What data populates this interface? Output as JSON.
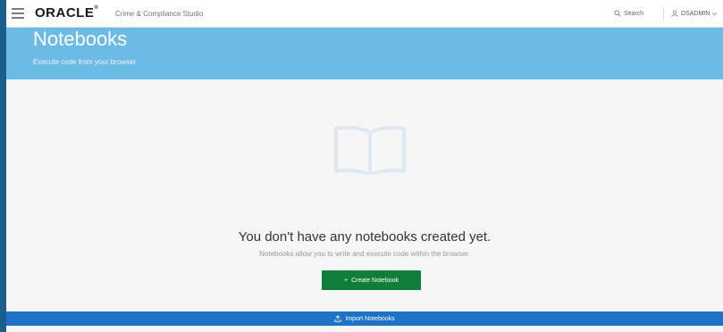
{
  "topbar": {
    "logo_text": "ORACLE",
    "logo_mark": "®",
    "product_name": "Crime & Compliance Studio",
    "search_label": "Search",
    "user_name": "DSADMIN"
  },
  "banner": {
    "title": "Notebooks",
    "subtitle": "Execute code from your browser"
  },
  "empty_state": {
    "icon": "book-open-icon",
    "title": "You don't have any notebooks created yet.",
    "description": "Notebooks allow you to write and execute code within the browser.",
    "create_label": "Create Notebook",
    "create_icon": "+"
  },
  "footer": {
    "import_label": "Import Notebooks"
  },
  "colors": {
    "banner": "#6cbae6",
    "create_button": "#0f7e3a",
    "import_bar": "#1f73c4"
  }
}
